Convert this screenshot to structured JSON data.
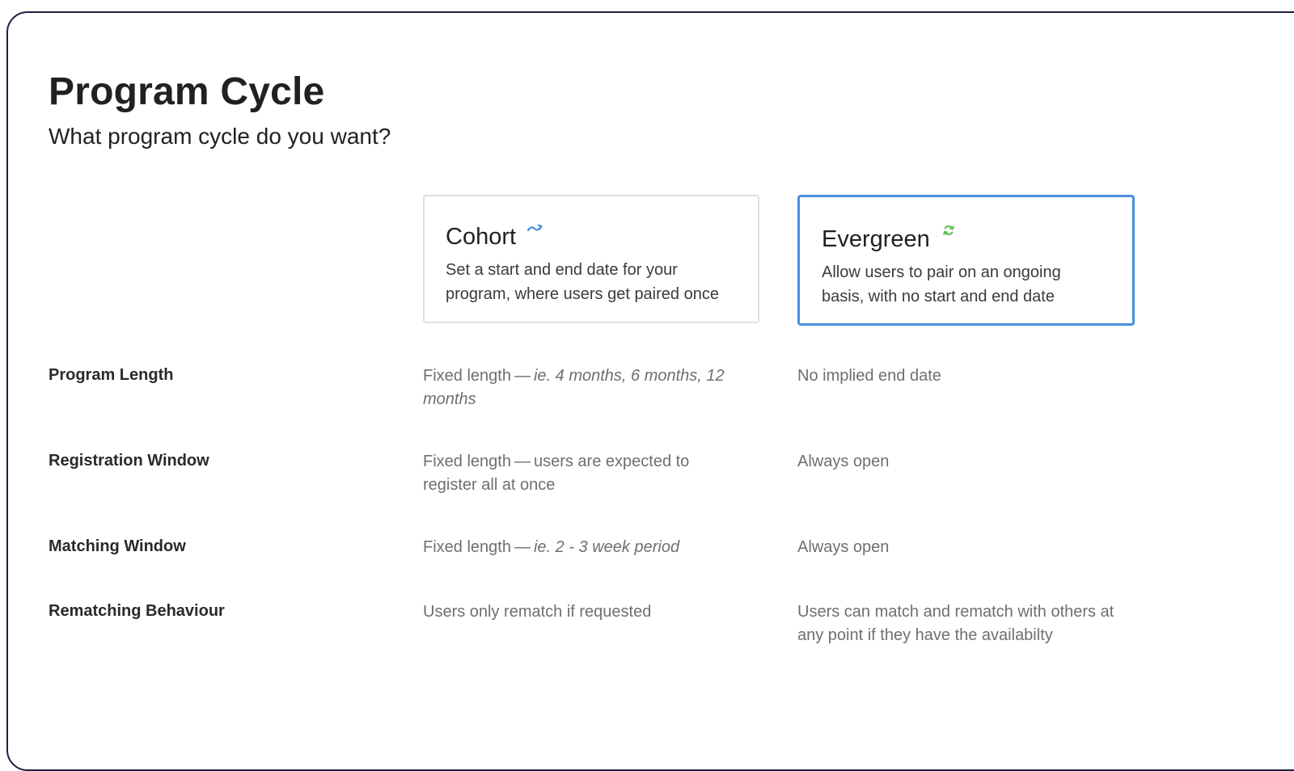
{
  "header": {
    "title": "Program Cycle",
    "subtitle": "What program cycle do you want?"
  },
  "options": [
    {
      "title": "Cohort",
      "icon": "arrow-curve-icon",
      "icon_color": "#4a8fe0",
      "description_line1": "Set a start and end date for your",
      "description_line2": "program, where users get paired once",
      "selected": false
    },
    {
      "title": "Evergreen",
      "icon": "refresh-icon",
      "icon_color": "#5bbd4f",
      "description_line1": "Allow users to pair on an ongoing",
      "description_line2": "basis, with no start and end date",
      "selected": true
    }
  ],
  "comparison": [
    {
      "label": "Program Length",
      "cohort_prefix": "Fixed length",
      "cohort_dash": "—",
      "cohort_italic": "ie. 4 months, 6 months, 12 months",
      "evergreen": "No implied end date"
    },
    {
      "label": "Registration Window",
      "cohort_prefix": "Fixed length",
      "cohort_dash": "—",
      "cohort_text": "users are expected to register all at once",
      "evergreen": "Always open"
    },
    {
      "label": "Matching Window",
      "cohort_prefix": "Fixed length",
      "cohort_dash": "—",
      "cohort_italic": "ie. 2 - 3 week period",
      "evergreen": "Always open"
    },
    {
      "label": "Rematching Behaviour",
      "cohort": "Users only rematch if requested",
      "evergreen": "Users can match and rematch with others at any point if they have the availabilty"
    }
  ]
}
